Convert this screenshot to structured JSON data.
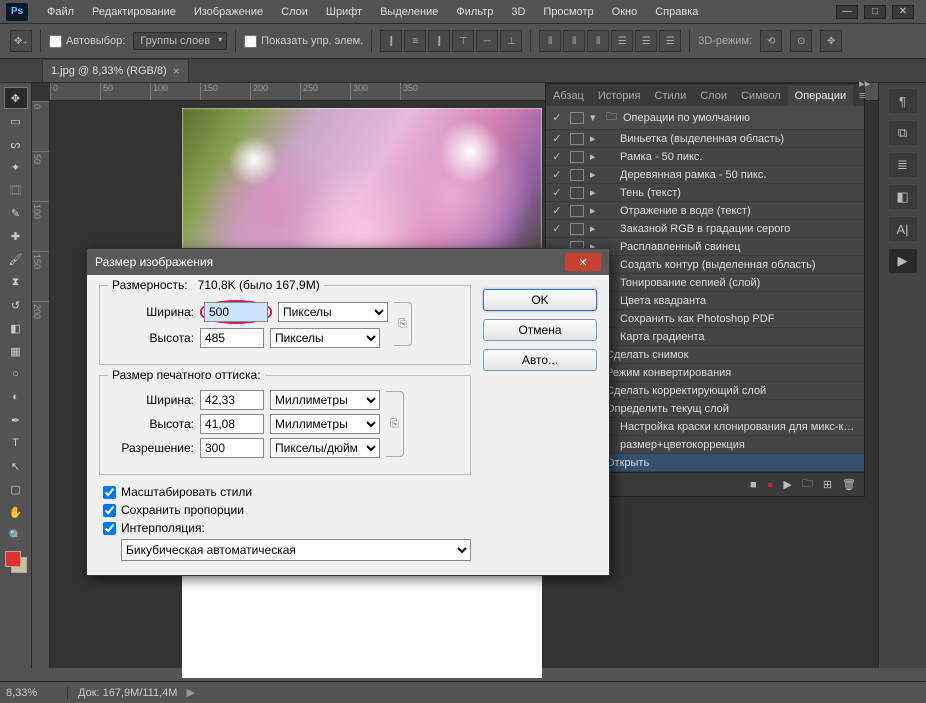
{
  "app_logo": "Ps",
  "menus": [
    "Файл",
    "Редактирование",
    "Изображение",
    "Слои",
    "Шрифт",
    "Выделение",
    "Фильтр",
    "3D",
    "Просмотр",
    "Окно",
    "Справка"
  ],
  "options_bar": {
    "auto_select": "Автовыбор:",
    "group_dd": "Группы слоев",
    "show_ctrl": "Показать упр. элем.",
    "mode3d": "3D-режим:"
  },
  "doc_tab": "1.jpg @ 8,33% (RGB/8)",
  "ruler_h": [
    "0",
    "50",
    "100",
    "150",
    "200",
    "250",
    "300",
    "350"
  ],
  "ruler_v": [
    "0",
    "50",
    "100",
    "150",
    "200"
  ],
  "actions": {
    "tabs": [
      "Абзац",
      "История",
      "Стили",
      "Слои",
      "Символ",
      "Операции"
    ],
    "set_name": "Операции по умолчанию",
    "items": [
      {
        "chk": true,
        "name": "Виньетка (выделенная область)"
      },
      {
        "chk": true,
        "name": "Рамка - 50 пикс."
      },
      {
        "chk": true,
        "name": "Деревянная рамка - 50 пикс."
      },
      {
        "chk": true,
        "name": "Тень (текст)"
      },
      {
        "chk": true,
        "name": "Отражение в воде (текст)"
      },
      {
        "chk": true,
        "name": "Заказной RGB в градации серого"
      },
      {
        "chk": false,
        "name": "Расплавленный свинец"
      },
      {
        "chk": false,
        "name": "Создать контур (выделенная область)"
      },
      {
        "chk": false,
        "name": "Тонирование сепией (слой)"
      },
      {
        "chk": false,
        "name": "Цвета квадранта"
      },
      {
        "chk": false,
        "name": "Сохранить как Photoshop PDF"
      },
      {
        "chk": false,
        "name": "Карта градиента"
      },
      {
        "chk": false,
        "name": "Сделать снимок",
        "arr": true
      },
      {
        "chk": false,
        "name": "Режим конвертирования",
        "arr": true
      },
      {
        "chk": false,
        "name": "Сделать корректирующий слой",
        "arr": true
      },
      {
        "chk": false,
        "name": "Определить текущ слой",
        "arr": true
      },
      {
        "chk": false,
        "name": "Настройка краски клонирования для микс-кисти"
      },
      {
        "chk": false,
        "name": "размер+цветокоррекция"
      },
      {
        "chk": false,
        "name": "Открыть",
        "arr": true,
        "hov": true
      }
    ]
  },
  "dialog": {
    "title": "Размер изображения",
    "dimensions_lbl": "Размерность:",
    "dimensions_val": "710,8K (было 167,9M)",
    "width_lbl": "Ширина:",
    "width_val": "500",
    "height_lbl": "Высота:",
    "height_val": "485",
    "pixels": "Пикселы",
    "print_title": "Размер печатного оттиска:",
    "p_width": "42,33",
    "p_height": "41,08",
    "mm": "Миллиметры",
    "res_lbl": "Разрешение:",
    "res_val": "300",
    "ppi": "Пикселы/дюйм",
    "scale_styles": "Масштабировать стили",
    "constrain": "Сохранить пропорции",
    "interp_lbl": "Интерполяция:",
    "interp_val": "Бикубическая автоматическая",
    "ok": "OK",
    "cancel": "Отмена",
    "auto": "Авто..."
  },
  "status": {
    "zoom": "8,33%",
    "doc_lbl": "Док:",
    "doc_val": "167,9M/111,4M"
  }
}
